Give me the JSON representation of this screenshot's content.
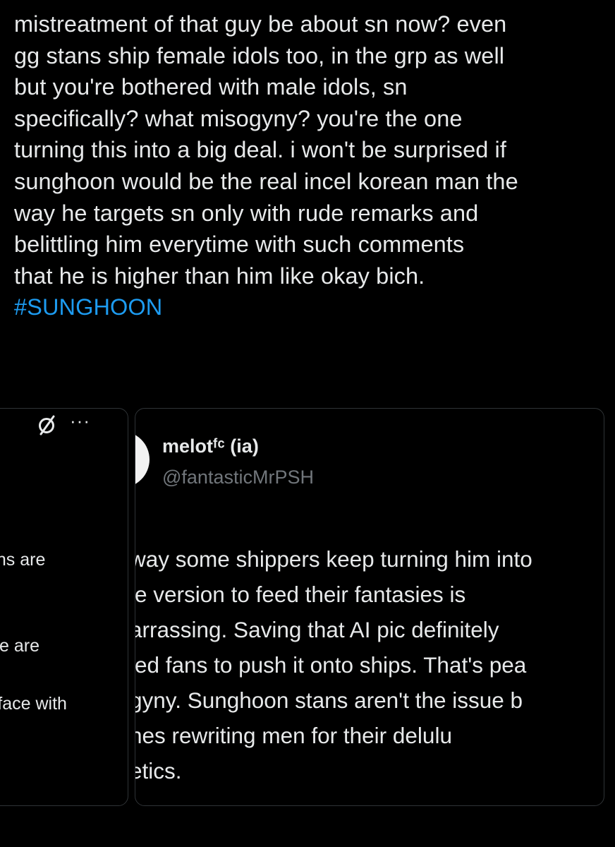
{
  "tweet": {
    "lines": [
      "mistreatment of that guy be about sn now? even",
      "gg stans ship female idols too, in the grp as well",
      "but you're bothered with male idols, sn",
      "specifically? what misogyny? you're the one",
      "turning this into a big deal. i won't be surprised if",
      "sunghoon would be the real incel korean man the",
      "way he targets sn only with rude remarks and",
      "belittling him everytime with such comments",
      "that he is higher than him like okay bich."
    ],
    "hashtag": "#SUNGHOON"
  },
  "left_card": {
    "icons": [
      "mute-icon",
      "more-icon"
    ],
    "more_label": "···",
    "fragments": [
      "ans are",
      "we are",
      "r face with"
    ]
  },
  "quoted_card": {
    "display_name": "melotᶠᶜ (ia)",
    "handle": "@fantasticMrPSH",
    "lines": [
      "way some shippers keep turning him into",
      "le version to feed their fantasies is",
      "arrassing. Saving that AI pic definitely",
      "led fans to push it onto ships. That's pea",
      "gyny. Sunghoon stans aren't the issue b",
      "nes rewriting men for their delulu",
      "etics."
    ]
  },
  "colors": {
    "background": "#000000",
    "text": "#e7e9ea",
    "hashtag": "#1d9bf0",
    "muted": "#71767b",
    "border": "#2f3336"
  }
}
